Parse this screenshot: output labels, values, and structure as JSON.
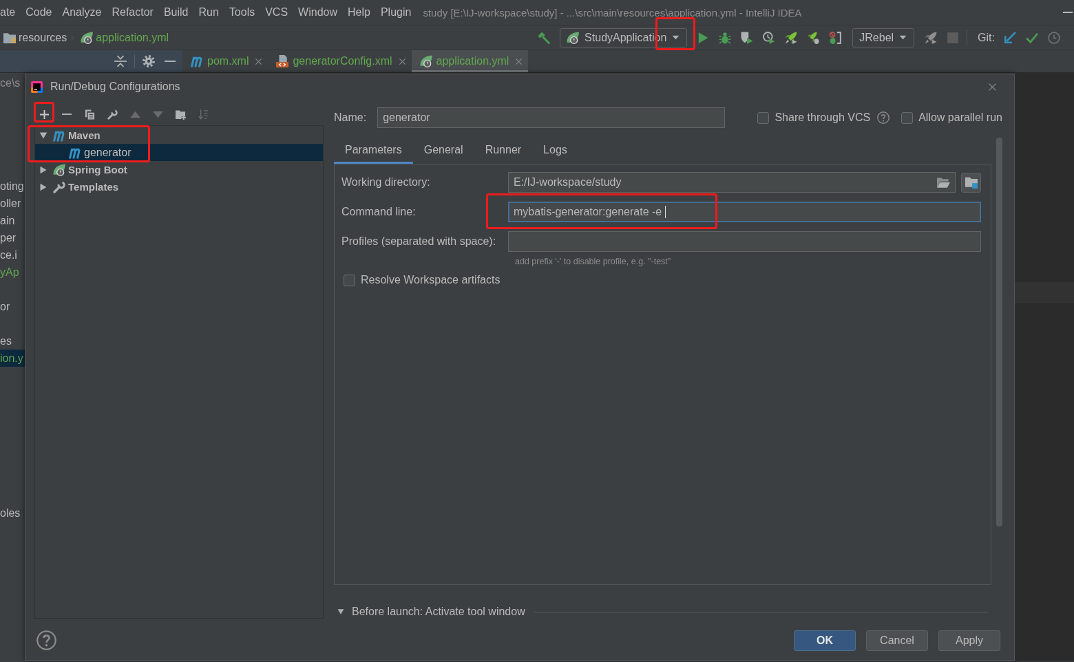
{
  "menu_bar": {
    "items": [
      "ate",
      "Code",
      "Analyze",
      "Refactor",
      "Build",
      "Run",
      "Tools",
      "VCS",
      "Window",
      "Help",
      "Plugin"
    ],
    "title": "study [E:\\IJ-workspace\\study] - ...\\src\\main\\resources\\application.yml - IntelliJ IDEA"
  },
  "navigation_bar": {
    "breadcrumbs": [
      {
        "label": "resources",
        "kind": "folder",
        "color": "#bbbbbb"
      },
      {
        "label": "application.yml",
        "kind": "spring",
        "color": "#62a84f"
      }
    ],
    "actions": [
      {
        "kind": "hammer",
        "disabled": false,
        "highlighted": false
      },
      {
        "kind": "run-config",
        "label": "StudyApplication",
        "disabled": false,
        "highlighted": true
      },
      {
        "kind": "run",
        "disabled": false,
        "highlighted": false
      },
      {
        "kind": "debug",
        "disabled": false,
        "highlighted": false
      },
      {
        "kind": "coverage",
        "disabled": false,
        "highlighted": false
      },
      {
        "kind": "profile",
        "disabled": false,
        "highlighted": false
      },
      {
        "kind": "rocket",
        "disabled": false,
        "highlighted": false
      },
      {
        "kind": "rocket-debug",
        "disabled": false,
        "highlighted": false
      },
      {
        "kind": "attach-debug",
        "disabled": false,
        "highlighted": false
      },
      {
        "kind": "dropdown",
        "label": "JRebel",
        "disabled": false,
        "highlighted": false
      },
      {
        "kind": "rocket",
        "disabled": true,
        "highlighted": false
      },
      {
        "kind": "stop",
        "disabled": true,
        "highlighted": false
      },
      {
        "kind": "separator"
      },
      {
        "kind": "text",
        "label": "Git:"
      },
      {
        "kind": "update",
        "disabled": false,
        "highlighted": false
      },
      {
        "kind": "commit",
        "disabled": false,
        "highlighted": false
      },
      {
        "kind": "history",
        "disabled": false,
        "highlighted": false
      }
    ]
  },
  "editor_tabs": [
    {
      "label": "pom.xml",
      "kind": "maven",
      "selected": false
    },
    {
      "label": "generatorConfig.xml",
      "kind": "xml",
      "selected": false
    },
    {
      "label": "application.yml",
      "kind": "spring",
      "selected": true
    }
  ],
  "project_panel": {
    "path": "ce\\s",
    "sections": [
      {
        "items": [
          {
            "label": "oting",
            "color": "#bbbbbb",
            "selected": false
          },
          {
            "label": "oller",
            "color": "#bbbbbb",
            "selected": false
          },
          {
            "label": "ain",
            "color": "#bbbbbb",
            "selected": false
          },
          {
            "label": "per",
            "color": "#bbbbbb",
            "selected": false
          },
          {
            "label": "ce.i",
            "color": "#bbbbbb",
            "selected": false
          },
          {
            "label": "yAp",
            "color": "#62a84f",
            "selected": false
          }
        ]
      },
      {
        "items": [
          {
            "label": "or",
            "color": "#bbbbbb",
            "selected": false
          }
        ]
      },
      {
        "items": [
          {
            "label": "es",
            "color": "#bbbbbb",
            "selected": false
          },
          {
            "label": "ion.y",
            "color": "#62a84f",
            "selected": true
          }
        ]
      },
      {
        "items": [
          {
            "label": "oles",
            "color": "#bbbbbb",
            "selected": false
          }
        ]
      }
    ]
  },
  "dialog": {
    "title": "Run/Debug Configurations",
    "toolbar": [
      {
        "kind": "add",
        "disabled": false,
        "highlighted": true
      },
      {
        "kind": "remove",
        "disabled": false,
        "highlighted": false
      },
      {
        "kind": "copy",
        "disabled": false,
        "highlighted": false
      },
      {
        "kind": "edit-templates",
        "disabled": false,
        "highlighted": false
      },
      {
        "kind": "move-up",
        "disabled": true,
        "highlighted": false
      },
      {
        "kind": "move-down",
        "disabled": true,
        "highlighted": false
      },
      {
        "kind": "new-folder",
        "disabled": false,
        "highlighted": false
      },
      {
        "kind": "sort",
        "disabled": true,
        "highlighted": false
      }
    ],
    "tree": [
      {
        "label": "Maven",
        "kind": "maven",
        "expanded": true,
        "selected": false,
        "highlighted": true,
        "children": [
          {
            "label": "generator",
            "kind": "maven",
            "selected": true,
            "highlighted": false
          }
        ]
      },
      {
        "label": "Spring Boot",
        "kind": "spring-boot",
        "expanded": false,
        "selected": false,
        "highlighted": false
      },
      {
        "label": "Templates",
        "kind": "templates",
        "expanded": false,
        "selected": false,
        "highlighted": false
      }
    ],
    "name_field": {
      "label": "Name:",
      "value": "generator"
    },
    "options": [
      {
        "label": "Share through VCS",
        "checked": false,
        "help": true
      },
      {
        "label": "Allow parallel run",
        "checked": false,
        "help": false
      }
    ],
    "tabs": [
      {
        "label": "Parameters",
        "selected": true
      },
      {
        "label": "General",
        "selected": false
      },
      {
        "label": "Runner",
        "selected": false
      },
      {
        "label": "Logs",
        "selected": false
      }
    ],
    "fields": [
      {
        "kind": "directory",
        "label": "Working directory:",
        "value": "E:/IJ-workspace/study",
        "focused": false,
        "highlighted": false
      },
      {
        "kind": "text",
        "label": "Command line:",
        "value": "mybatis-generator:generate -e",
        "focused": true,
        "highlighted": true
      },
      {
        "kind": "text",
        "label": "Profiles (separated with space):",
        "focused": false,
        "highlighted": false,
        "hint": "add prefix '-' to disable profile, e.g. \"-test\""
      }
    ],
    "resolve_workspace": {
      "label": "Resolve Workspace artifacts",
      "checked": false
    },
    "before_launch": {
      "label": "Before launch: Activate tool window",
      "expanded": true
    },
    "buttons": [
      {
        "label": "OK",
        "kind": "primary"
      },
      {
        "label": "Cancel",
        "kind": "secondary"
      },
      {
        "label": "Apply",
        "kind": "secondary"
      }
    ]
  }
}
